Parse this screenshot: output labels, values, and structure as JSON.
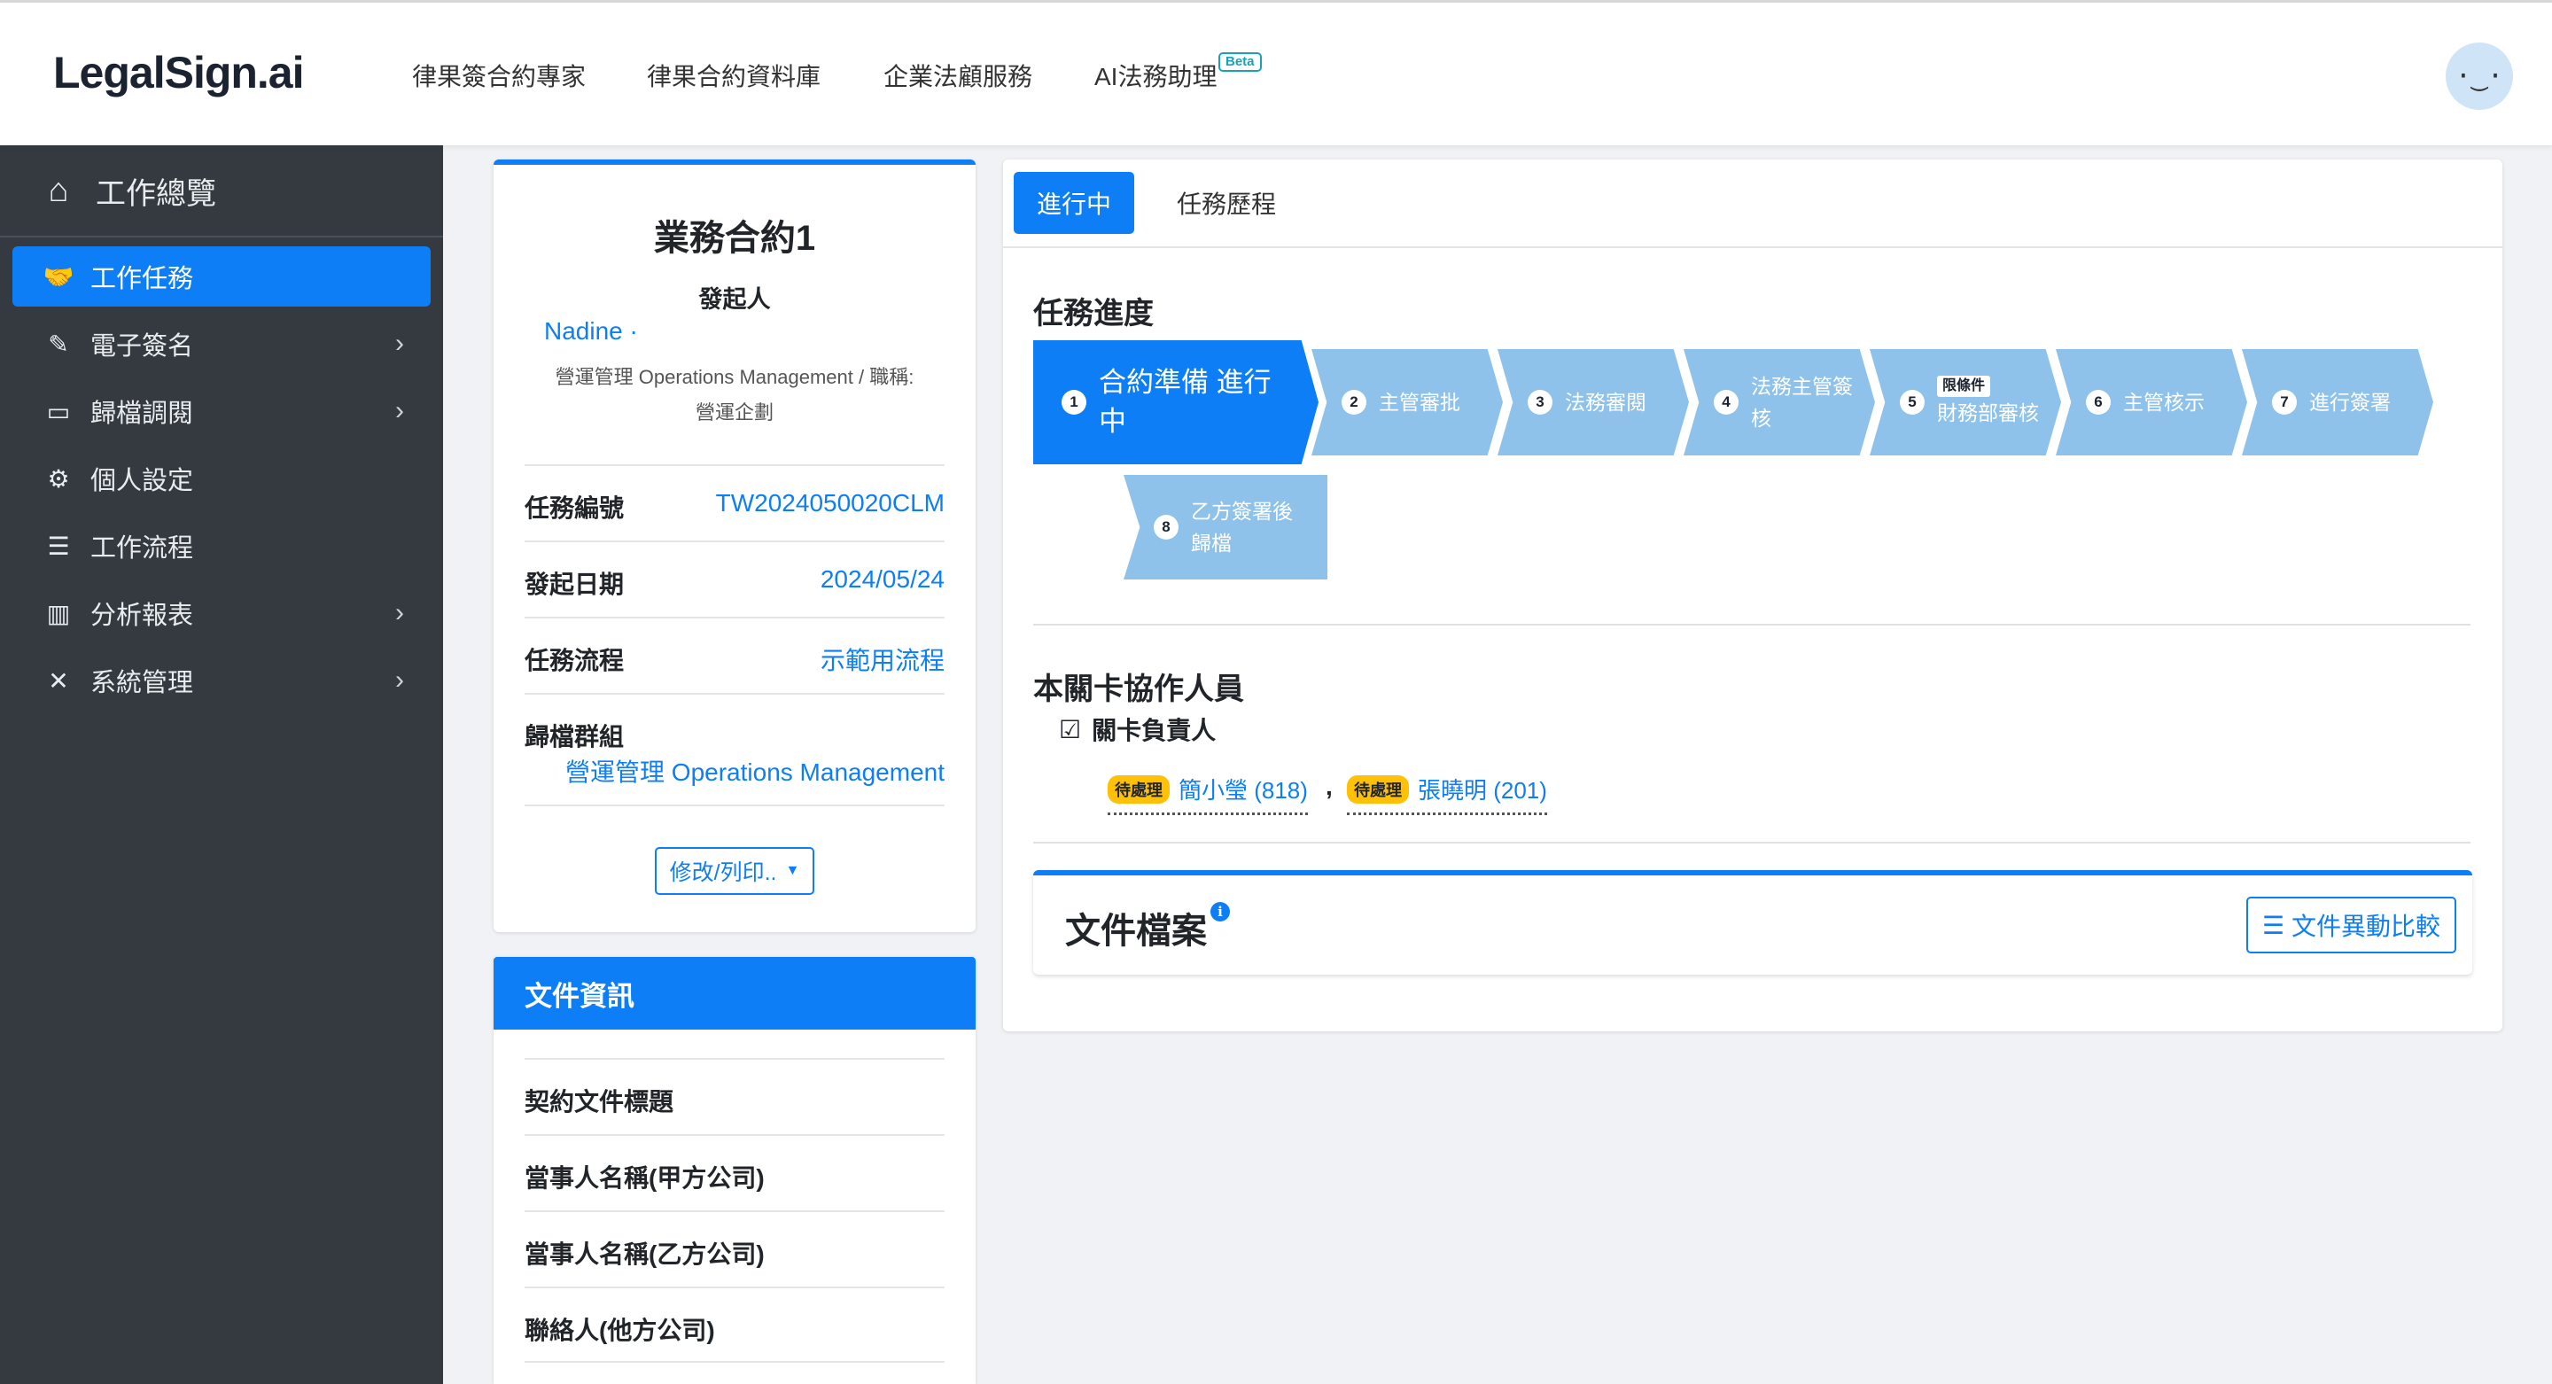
{
  "header": {
    "logo": "LegalSign.ai",
    "nav": [
      "律果簽合約專家",
      "律果合約資料庫",
      "企業法顧服務",
      "AI法務助理"
    ],
    "beta": "Beta",
    "avatar": "·‿·"
  },
  "sidebar": {
    "home": {
      "label": "工作總覽",
      "icon": "home-icon"
    },
    "items": [
      {
        "label": "工作任務",
        "icon": "handshake-icon",
        "active": true
      },
      {
        "label": "電子簽名",
        "icon": "signature-icon",
        "chevron": true
      },
      {
        "label": "歸檔調閱",
        "icon": "archive-icon",
        "chevron": true
      },
      {
        "label": "個人設定",
        "icon": "user-gear-icon"
      },
      {
        "label": "工作流程",
        "icon": "list-check-icon"
      },
      {
        "label": "分析報表",
        "icon": "bar-chart-icon",
        "chevron": true
      },
      {
        "label": "系統管理",
        "icon": "tools-icon",
        "chevron": true
      }
    ]
  },
  "contract": {
    "title": "業務合約1",
    "initiator_label": "發起人",
    "initiator_name": "Nadine ·",
    "initiator_dept_line1": "營運管理 Operations Management / 職稱:",
    "initiator_dept_line2": "營運企劃",
    "rows": [
      {
        "key": "任務編號",
        "value": "TW2024050020CLM"
      },
      {
        "key": "發起日期",
        "value": "2024/05/24"
      },
      {
        "key": "任務流程",
        "value": "示範用流程"
      },
      {
        "key": "歸檔群組",
        "value": "營運管理 Operations Management"
      }
    ],
    "edit_button": "修改/列印.."
  },
  "doc_info": {
    "title": "文件資訊",
    "rows": [
      "契約文件標題",
      "當事人名稱(甲方公司)",
      "當事人名稱(乙方公司)",
      "聯絡人(他方公司)"
    ]
  },
  "main": {
    "tabs": [
      "進行中",
      "任務歷程"
    ],
    "progress_title": "任務進度",
    "steps": [
      {
        "num": "1",
        "label": "合約準備 進行中",
        "state": "active"
      },
      {
        "num": "2",
        "label": "主管審批",
        "state": "pending"
      },
      {
        "num": "3",
        "label": "法務審閱",
        "state": "pending"
      },
      {
        "num": "4",
        "label": "法務主管簽核",
        "state": "pending"
      },
      {
        "num": "5",
        "label": "財務部審核",
        "badge": "限條件",
        "state": "pending"
      },
      {
        "num": "6",
        "label": "主管核示",
        "state": "pending"
      },
      {
        "num": "7",
        "label": "進行簽署",
        "state": "pending"
      },
      {
        "num": "8",
        "label": "乙方簽署後歸檔",
        "state": "pending"
      }
    ],
    "collab_title": "本關卡協作人員",
    "owner_label": "關卡負責人",
    "people": [
      {
        "badge": "待處理",
        "name": "簡小瑩 (818)"
      },
      {
        "badge": "待處理",
        "name": "張曉明 (201)"
      }
    ],
    "separator": ",",
    "files_title": "文件檔案",
    "info_icon": "i",
    "compare_button": "文件異動比較"
  }
}
